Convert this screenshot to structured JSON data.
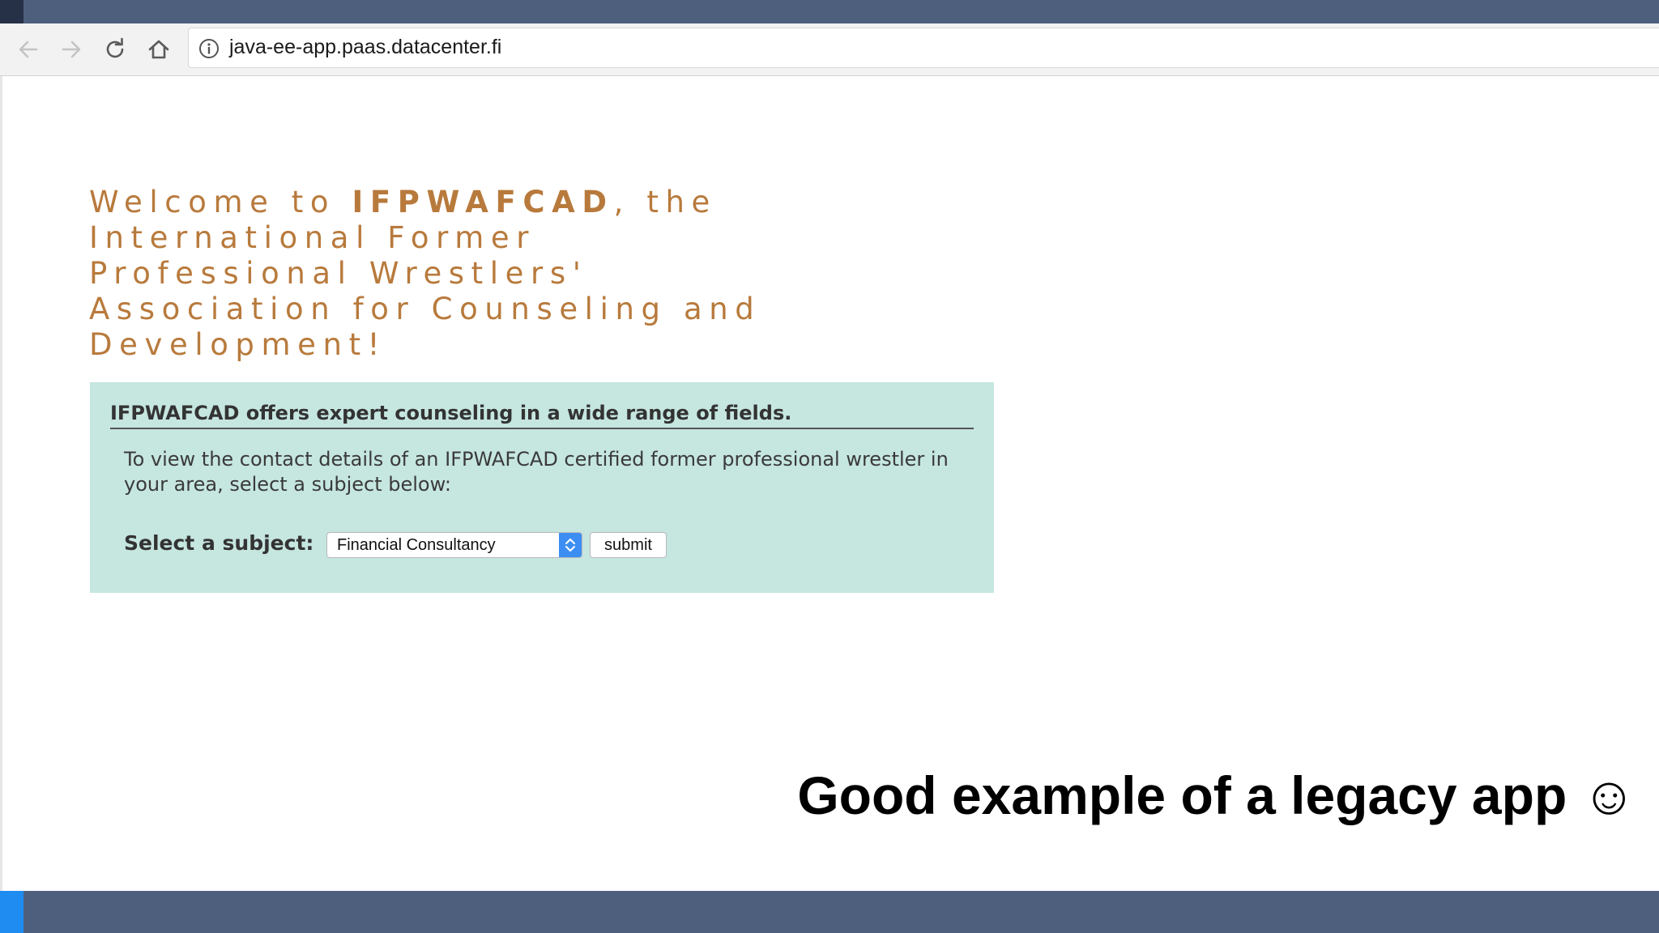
{
  "browser": {
    "url": "java-ee-app.paas.datacenter.fi",
    "icons": {
      "back": "back-arrow-icon",
      "forward": "forward-arrow-icon",
      "reload": "reload-icon",
      "home": "home-icon",
      "site_info": "info-icon"
    }
  },
  "page": {
    "welcome_prefix": "Welcome to ",
    "welcome_brand": "IFPWAFCAD",
    "welcome_suffix": ", the International Former Professional Wrestlers' Association for Counseling and Development!",
    "panel_heading": "IFPWAFCAD offers expert counseling in a wide range of fields.",
    "panel_text": "To view the contact details of an IFPWAFCAD certified former professional wrestler in your area, select a subject below:",
    "select_label": "Select a subject:",
    "select_value": "Financial Consultancy",
    "submit_label": "submit"
  },
  "slide": {
    "caption": "Good example of a legacy app ☺"
  },
  "colors": {
    "slide_bar": "#4e5f7e",
    "slide_bar_accent_top": "#263147",
    "slide_bar_accent_bottom": "#1e8cf0",
    "welcome_text": "#b87a3c",
    "panel_bg": "#c6e6e0",
    "select_arrow_bg": "#3d8ef2"
  }
}
